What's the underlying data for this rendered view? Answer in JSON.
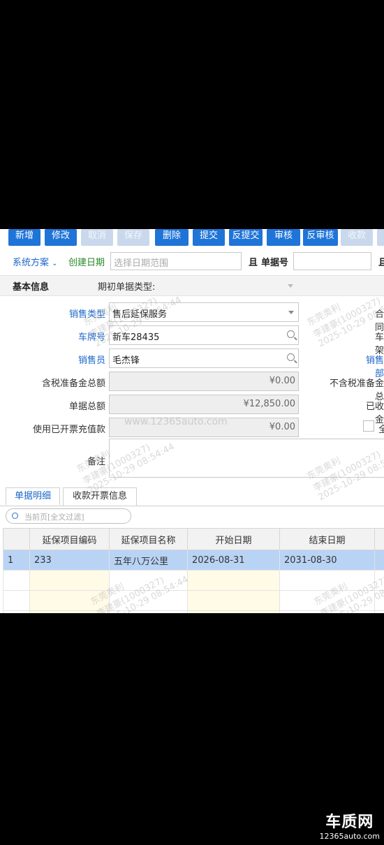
{
  "toolbar": {
    "buttons": [
      "新增",
      "修改",
      "取消",
      "保存",
      "删除",
      "提交",
      "反提交",
      "审核",
      "反审核",
      "收款"
    ]
  },
  "filter": {
    "scheme_label": "系统方案",
    "date_label": "创建日期",
    "date_placeholder": "选择日期范围",
    "and_label": "且",
    "docno_label": "单据号",
    "and2_label": "且"
  },
  "section": {
    "title": "基本信息",
    "initial_type_label": "期初单据类型:"
  },
  "form": {
    "sales_type_label": "销售类型",
    "sales_type_value": "售后延保服务",
    "contract_label": "合同",
    "plate_label": "车牌号",
    "plate_value": "新车28435",
    "vin_label": "车架",
    "salesman_label": "销售员",
    "salesman_value": "毛杰锋",
    "sales_dept_label": "销售部",
    "tax_reserve_label": "含税准备金总额",
    "tax_reserve_value": "¥0.00",
    "notax_reserve_label": "不含税准备金总",
    "doc_total_label": "单据总额",
    "doc_total_value": "¥12,850.00",
    "received_label": "已收金",
    "prepaid_used_label": "使用已开票充值款",
    "prepaid_used_value": "¥0.00",
    "checkbox_label": "全",
    "remark_label": "备注"
  },
  "tabs": [
    "单据明细",
    "收款开票信息"
  ],
  "search": {
    "placeholder": "当前页[全文过滤]"
  },
  "table": {
    "headers": [
      "延保项目编码",
      "延保项目名称",
      "开始日期",
      "结束日期"
    ],
    "rows": [
      {
        "no": "1",
        "code": "233",
        "name": "五年八万公里",
        "start": "2026-08-31",
        "end": "2031-08-30"
      }
    ]
  },
  "watermark": {
    "line1": "东莞奥利",
    "line2": "李建豪(1000327)",
    "line3": "2025-10-29 08:54:44",
    "site": "www.12365auto.com"
  },
  "brand": {
    "name": "车质网",
    "site": "12365auto.com"
  },
  "colors": {
    "accent": "#1f74d8",
    "label_blue": "#1a66c9",
    "selected_row": "#b9d3f5"
  }
}
